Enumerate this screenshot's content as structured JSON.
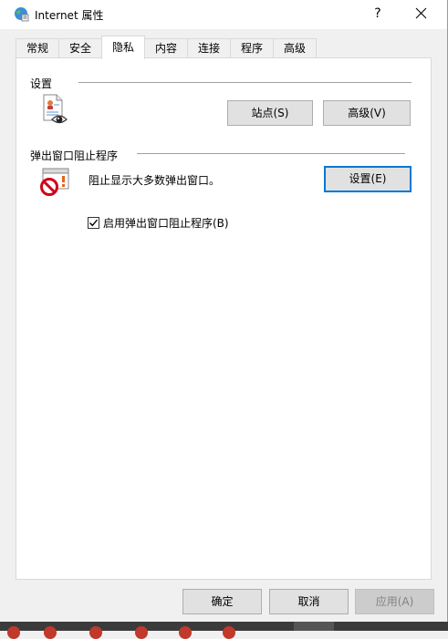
{
  "window": {
    "title": "Internet 属性",
    "help_label": "?",
    "icon": "internet-options-icon",
    "close_icon": "close-icon"
  },
  "tabs": [
    {
      "label": "常规",
      "active": false
    },
    {
      "label": "安全",
      "active": false
    },
    {
      "label": "隐私",
      "active": true
    },
    {
      "label": "内容",
      "active": false
    },
    {
      "label": "连接",
      "active": false
    },
    {
      "label": "程序",
      "active": false
    },
    {
      "label": "高级",
      "active": false
    }
  ],
  "settings_group": {
    "label": "设置",
    "icon": "privacy-document-eye-icon",
    "sites_button": "站点(S)",
    "advanced_button": "高级(V)"
  },
  "popup_group": {
    "label": "弹出窗口阻止程序",
    "icon": "popup-blocked-icon",
    "description": "阻止显示大多数弹出窗口。",
    "settings_button": "设置(E)",
    "enable_checkbox": {
      "label": "启用弹出窗口阻止程序(B)",
      "checked": true
    }
  },
  "footer": {
    "ok": "确定",
    "cancel": "取消",
    "apply": "应用(A)"
  },
  "colors": {
    "accent": "#0078d7",
    "blocked_red": "#d0021b",
    "taskbar": "#3b3b3b"
  }
}
